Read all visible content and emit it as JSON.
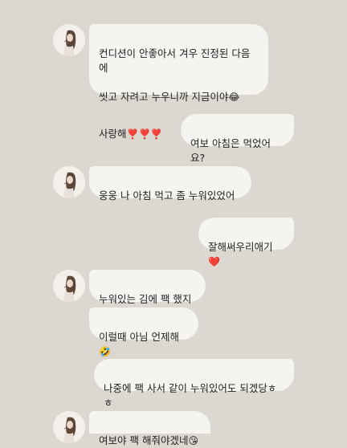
{
  "messages": [
    {
      "from": "partner",
      "line1": "컨디션이 안좋아서 겨우 진정된 다음에",
      "line2": "씻고 자려고 누우니까 지금이야",
      "emoji2": "😂",
      "line3": "사랑해",
      "emoji3": "❣️❣️❣️"
    },
    {
      "from": "me",
      "text": "여보 아침은 먹었어요?"
    },
    {
      "from": "partner",
      "text": "웅웅 나 아침 먹고 좀 누워있었어"
    },
    {
      "from": "me",
      "text": "잘해써우리애기",
      "emoji": "❤️"
    },
    {
      "from": "partner",
      "text": "누워있는 김에 팩 했지~"
    },
    {
      "from": "partner",
      "text": "이럴때 아님 언제해",
      "emoji": "🤣"
    },
    {
      "from": "me",
      "text": "나중에 팩 사서 같이 누워있어도 되겠당ㅎㅎ"
    },
    {
      "from": "partner",
      "text": "여보야 팩 해줘야겠네",
      "emoji": "😘"
    }
  ]
}
